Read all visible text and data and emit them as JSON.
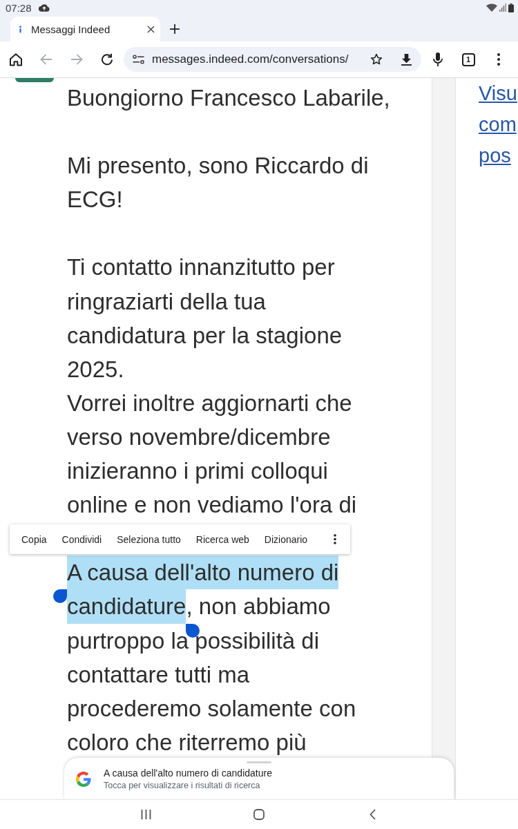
{
  "status_bar": {
    "time": "07:28"
  },
  "tabs": [
    {
      "title": "Messaggi Indeed",
      "selected": true
    }
  ],
  "toolbar": {
    "buttons": [
      {
        "kind": "home",
        "disabled": false
      },
      {
        "kind": "back",
        "disabled": true
      },
      {
        "kind": "forward",
        "disabled": true
      },
      {
        "kind": "reload",
        "disabled": false
      }
    ],
    "url": "messages.indeed.com/conversations/",
    "tab_count": "1"
  },
  "message": {
    "paragraphs": [
      {
        "lines": [
          {
            "segments": [
              {
                "text": "Buongiorno Francesco Labarile,",
                "selected": false
              }
            ]
          }
        ]
      },
      {
        "lines": [
          {
            "segments": [
              {
                "text": "Mi presento, sono Riccardo di",
                "selected": false
              }
            ]
          },
          {
            "segments": [
              {
                "text": "ECG!",
                "selected": false
              }
            ]
          }
        ]
      },
      {
        "lines": [
          {
            "segments": [
              {
                "text": "Ti contatto innanzitutto per",
                "selected": false
              }
            ]
          },
          {
            "segments": [
              {
                "text": "ringraziarti della tua",
                "selected": false
              }
            ]
          },
          {
            "segments": [
              {
                "text": "candidatura per la stagione",
                "selected": false
              }
            ]
          },
          {
            "segments": [
              {
                "text": "2025.",
                "selected": false
              }
            ]
          },
          {
            "segments": [
              {
                "text": "Vorrei inoltre aggiornarti che",
                "selected": false
              }
            ]
          },
          {
            "segments": [
              {
                "text": "verso novembre/dicembre",
                "selected": false
              }
            ]
          },
          {
            "segments": [
              {
                "text": "inizieranno i primi colloqui",
                "selected": false
              }
            ]
          },
          {
            "segments": [
              {
                "text": "online e non vediamo l'ora di",
                "selected": false
              }
            ]
          }
        ]
      },
      {
        "lines": [
          {
            "segments": [
              {
                "text": "A causa dell'alto numero di",
                "selected": true
              }
            ]
          },
          {
            "segments": [
              {
                "text": "candidature",
                "selected": true
              },
              {
                "text": ", non abbiamo",
                "selected": false
              }
            ]
          },
          {
            "segments": [
              {
                "text": "purtroppo la possibilità di",
                "selected": false
              }
            ]
          },
          {
            "segments": [
              {
                "text": "contattare tutti ma",
                "selected": false
              }
            ]
          },
          {
            "segments": [
              {
                "text": "procederemo solamente con",
                "selected": false
              }
            ]
          },
          {
            "segments": [
              {
                "text": "coloro che riterremo più",
                "selected": false
              }
            ]
          }
        ]
      }
    ]
  },
  "side_links": [
    "Visu",
    "com",
    "pos"
  ],
  "context_menu": {
    "items": [
      "Copia",
      "Condividi",
      "Seleziona tutto",
      "Ricerca web",
      "Dizionario"
    ]
  },
  "search_sheet": {
    "title": "A causa dell'alto numero di candidature",
    "subtitle": "Tocca per visualizzare i risultati di ricerca"
  }
}
